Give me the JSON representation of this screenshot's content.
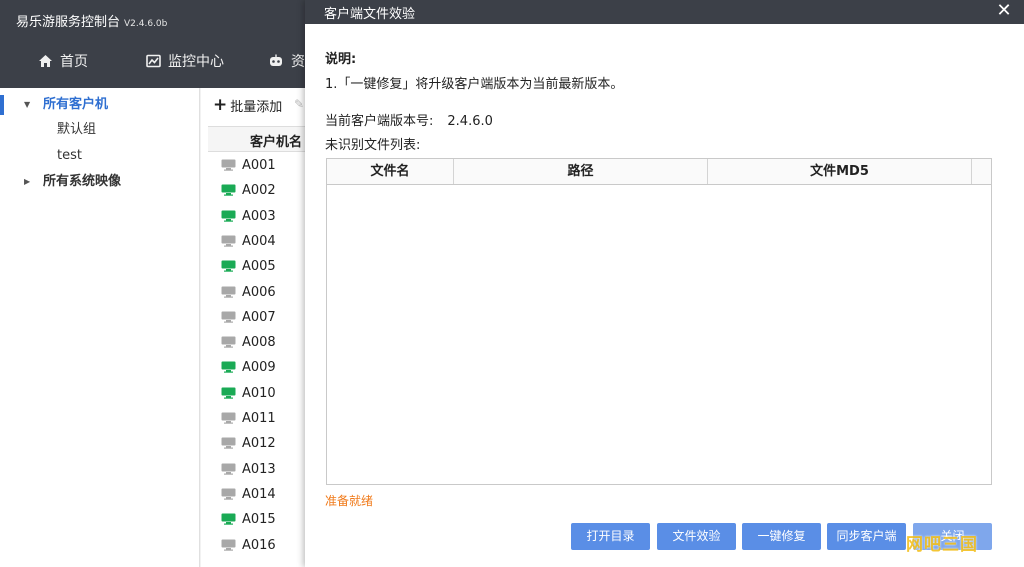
{
  "app": {
    "title": "易乐游服务控制台",
    "version": "V2.4.6.0b"
  },
  "nav": {
    "home": "首页",
    "monitor": "监控中心",
    "resources": "资"
  },
  "tree": {
    "all_clients": "所有客户机",
    "default_group": "默认组",
    "test_group": "test",
    "all_images": "所有系统映像"
  },
  "client_list": {
    "batch_add": "批量添加",
    "column_name": "客户机名",
    "clients": [
      {
        "name": "A001",
        "status": "offline"
      },
      {
        "name": "A002",
        "status": "online"
      },
      {
        "name": "A003",
        "status": "online"
      },
      {
        "name": "A004",
        "status": "offline"
      },
      {
        "name": "A005",
        "status": "online"
      },
      {
        "name": "A006",
        "status": "offline"
      },
      {
        "name": "A007",
        "status": "offline"
      },
      {
        "name": "A008",
        "status": "offline"
      },
      {
        "name": "A009",
        "status": "online"
      },
      {
        "name": "A010",
        "status": "online"
      },
      {
        "name": "A011",
        "status": "offline"
      },
      {
        "name": "A012",
        "status": "offline"
      },
      {
        "name": "A013",
        "status": "offline"
      },
      {
        "name": "A014",
        "status": "offline"
      },
      {
        "name": "A015",
        "status": "online"
      },
      {
        "name": "A016",
        "status": "offline"
      }
    ]
  },
  "dialog": {
    "title": "客户端文件效验",
    "close": "✕",
    "desc_heading": "说明:",
    "desc_line": "1.「一键修复」将升级客户端版本为当前最新版本。",
    "version_label": "当前客户端版本号:",
    "version_value": "2.4.6.0",
    "list_label": "未识别文件列表:",
    "columns": {
      "name": "文件名",
      "path": "路径",
      "md5": "文件MD5"
    },
    "rows": [],
    "status": "准备就绪",
    "buttons": {
      "open_dir": "打开目录",
      "verify": "文件效验",
      "repair": "一键修复",
      "sync": "同步客户端",
      "close": "关闭"
    }
  },
  "watermark": "网吧三国",
  "colors": {
    "header_bg": "#3c4048",
    "accent_blue": "#2f6fd1",
    "button_blue": "#5a8ee6",
    "online_green": "#1aaa55",
    "offline_gray": "#a8a8a8",
    "status_orange": "#f07a1a"
  },
  "icons": {
    "home": "home-icon",
    "monitor": "monitor-chart-icon",
    "resources": "robot-icon",
    "client": "pc-monitor-icon"
  }
}
